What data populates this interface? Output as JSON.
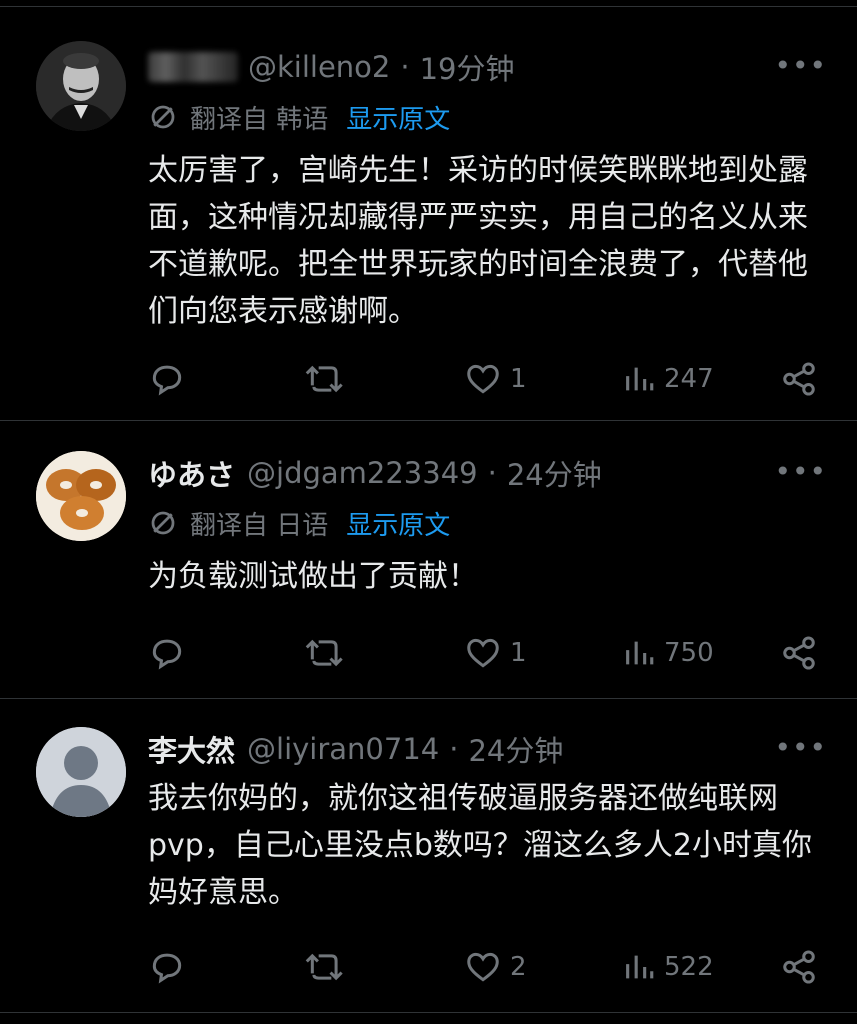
{
  "tweets": [
    {
      "name": "",
      "handle": "@killeno2",
      "time": "19分钟",
      "translate_label": "翻译自 韩语",
      "show_original": "显示原文",
      "text": "太厉害了，宫崎先生！采访的时候笑眯眯地到处露面，这种情况却藏得严严实实，用自己的名义从来不道歉呢。把全世界玩家的时间全浪费了，代替他们向您表示感谢啊。",
      "replies": "",
      "retweets": "",
      "likes": "1",
      "views": "247"
    },
    {
      "name": "ゆあさ",
      "handle": "@jdgam223349",
      "time": "24分钟",
      "translate_label": "翻译自 日语",
      "show_original": "显示原文",
      "text": "为负载测试做出了贡献！",
      "replies": "",
      "retweets": "",
      "likes": "1",
      "views": "750"
    },
    {
      "name": "李大然",
      "handle": "@liyiran0714",
      "time": "24分钟",
      "text": "我去你妈的，就你这祖传破逼服务器还做纯联网pvp，自己心里没点b数吗？溜这么多人2小时真你妈好意思。",
      "replies": "",
      "retweets": "",
      "likes": "2",
      "views": "522"
    }
  ],
  "separator": "·",
  "more_label": "•••",
  "icons": {
    "reply": "reply-icon",
    "retweet": "retweet-icon",
    "like": "heart-icon",
    "views": "views-icon",
    "share": "share-icon",
    "translate": "translate-icon"
  },
  "colors": {
    "background": "#000000",
    "text": "#e7e9ea",
    "muted": "#71767b",
    "link": "#1d9bf0",
    "divider": "#2f3336"
  }
}
